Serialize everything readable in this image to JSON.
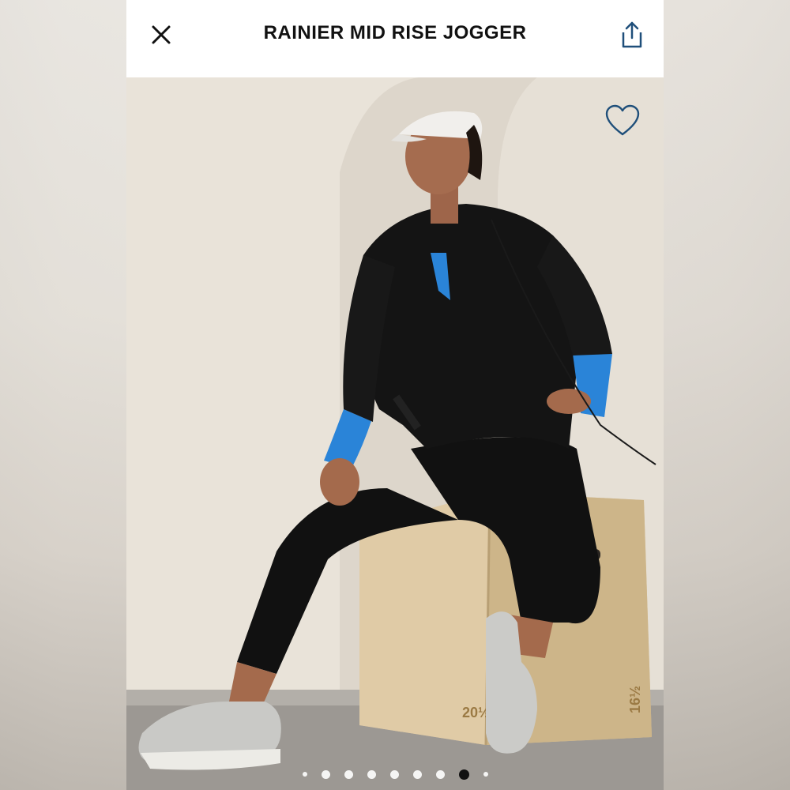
{
  "header": {
    "title": "RAINIER MID RISE JOGGER",
    "close_icon": "close-icon",
    "share_icon": "share-icon"
  },
  "product_image": {
    "favorite_icon": "heart-outline-icon",
    "box_markings": [
      "20½",
      "16½"
    ]
  },
  "carousel": {
    "total_dots": 9,
    "active_index": 7
  },
  "colors": {
    "accent": "#1f4f7a",
    "background": "#ffffff"
  }
}
